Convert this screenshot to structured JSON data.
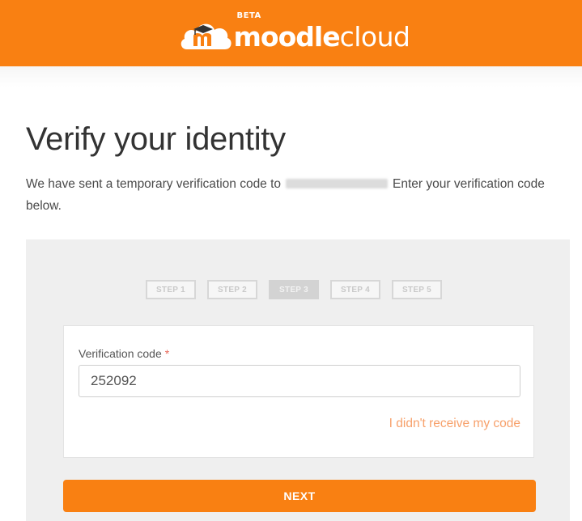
{
  "header": {
    "brand_bold": "moodle",
    "brand_light": "cloud",
    "beta_badge": "BETA",
    "logo_icon": "moodle-m-cloud-icon",
    "color": "#f98012"
  },
  "main": {
    "title": "Verify your identity",
    "intro_before": "We have sent a temporary verification code to",
    "intro_after": "Enter your verification code below."
  },
  "steps": [
    {
      "label": "STEP 1",
      "active": false
    },
    {
      "label": "STEP 2",
      "active": false
    },
    {
      "label": "STEP 3",
      "active": true
    },
    {
      "label": "STEP 4",
      "active": false
    },
    {
      "label": "STEP 5",
      "active": false
    }
  ],
  "form": {
    "code_label": "Verification code",
    "required_marker": "*",
    "code_value": "252092",
    "resend_link": "I didn't receive my code",
    "next_label": "NEXT"
  },
  "colors": {
    "accent": "#f98012",
    "link": "#f7a06a",
    "required": "#e86a5a",
    "panel": "#efefef"
  }
}
